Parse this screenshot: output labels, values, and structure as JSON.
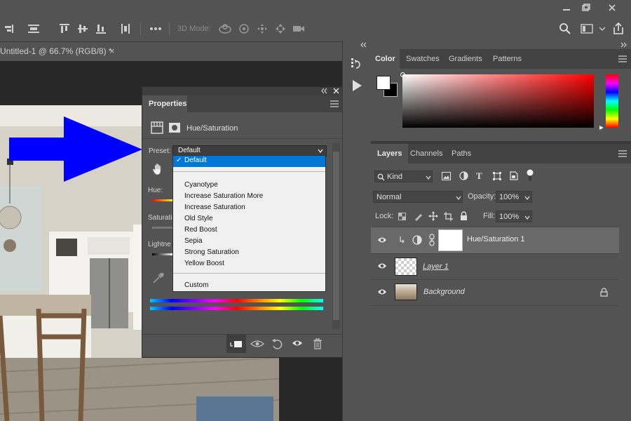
{
  "document": {
    "tab_title": "Untitled-1 @ 66.7% (RGB/8) *",
    "close": "×"
  },
  "options_bar": {
    "mode_label": "3D Mode:"
  },
  "properties_panel": {
    "title": "Properties",
    "adjustment_name": "Hue/Saturation",
    "preset_label": "Preset:",
    "preset_value": "Default",
    "hue_label": "Hue:",
    "saturation_label": "Saturatio",
    "lightness_label": "Lightne"
  },
  "preset_dropdown": {
    "selected": "Default",
    "options": [
      "Cyanotype",
      "Increase Saturation More",
      "Increase Saturation",
      "Old Style",
      "Red Boost",
      "Sepia",
      "Strong Saturation",
      "Yellow Boost"
    ],
    "custom": "Custom"
  },
  "color_panel": {
    "tabs": [
      "Color",
      "Swatches",
      "Gradients",
      "Patterns"
    ]
  },
  "layers_panel": {
    "tabs": [
      "Layers",
      "Channels",
      "Paths"
    ],
    "filter_kind": "Kind",
    "blend_mode": "Normal",
    "opacity_label": "Opacity:",
    "opacity_value": "100%",
    "lock_label": "Lock:",
    "fill_label": "Fill:",
    "fill_value": "100%",
    "layers": [
      {
        "name": "Hue/Saturation 1"
      },
      {
        "name": "Layer 1"
      },
      {
        "name": "Background"
      }
    ]
  },
  "colors": {
    "arrow": "#0000ff",
    "selected_item": "#0078d7",
    "panel_bg": "#535353"
  },
  "icons": [
    "search-icon",
    "workspace-icon",
    "share-icon",
    "eye-icon",
    "lock-icon",
    "trash-icon"
  ]
}
